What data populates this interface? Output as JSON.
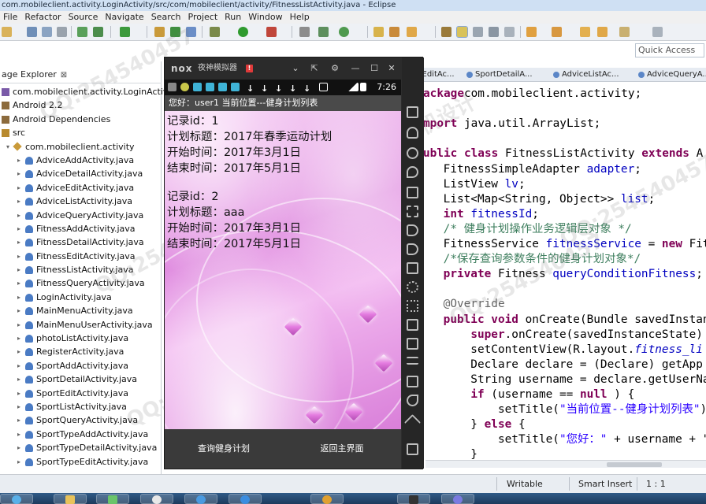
{
  "window": {
    "title": "com.mobileclient.activity.LoginActivity/src/com/mobileclient/activity/FitnessListActivity.java - Eclipse"
  },
  "menu": [
    "File",
    "Refactor",
    "Source",
    "Navigate",
    "Search",
    "Project",
    "Run",
    "Window",
    "Help"
  ],
  "quick_access": {
    "placeholder": "Quick Access"
  },
  "package_explorer": {
    "tab_label": "age Explorer",
    "close_glyph": "⊠",
    "tree": [
      {
        "label": "com.mobileclient.activity.LoginActivity",
        "level": 0,
        "icon": "project-icon",
        "arrow": ""
      },
      {
        "label": "Android 2.2",
        "level": 0,
        "icon": "library-icon",
        "arrow": ""
      },
      {
        "label": "Android Dependencies",
        "level": 0,
        "icon": "library-icon",
        "arrow": ""
      },
      {
        "label": "src",
        "level": 0,
        "icon": "source-folder-icon",
        "arrow": ""
      },
      {
        "label": "com.mobileclient.activity",
        "level": 1,
        "icon": "package-icon",
        "arrow": "▾"
      },
      {
        "label": "AdviceAddActivity.java",
        "level": 2,
        "icon": "java-file-icon",
        "arrow": "▸"
      },
      {
        "label": "AdviceDetailActivity.java",
        "level": 2,
        "icon": "java-file-icon",
        "arrow": "▸"
      },
      {
        "label": "AdviceEditActivity.java",
        "level": 2,
        "icon": "java-file-icon",
        "arrow": "▸"
      },
      {
        "label": "AdviceListActivity.java",
        "level": 2,
        "icon": "java-file-icon",
        "arrow": "▸"
      },
      {
        "label": "AdviceQueryActivity.java",
        "level": 2,
        "icon": "java-file-icon",
        "arrow": "▸"
      },
      {
        "label": "FitnessAddActivity.java",
        "level": 2,
        "icon": "java-file-icon",
        "arrow": "▸"
      },
      {
        "label": "FitnessDetailActivity.java",
        "level": 2,
        "icon": "java-file-icon",
        "arrow": "▸"
      },
      {
        "label": "FitnessEditActivity.java",
        "level": 2,
        "icon": "java-file-icon",
        "arrow": "▸"
      },
      {
        "label": "FitnessListActivity.java",
        "level": 2,
        "icon": "java-file-icon",
        "arrow": "▸"
      },
      {
        "label": "FitnessQueryActivity.java",
        "level": 2,
        "icon": "java-file-icon",
        "arrow": "▸"
      },
      {
        "label": "LoginActivity.java",
        "level": 2,
        "icon": "java-file-icon",
        "arrow": "▸"
      },
      {
        "label": "MainMenuActivity.java",
        "level": 2,
        "icon": "java-file-icon",
        "arrow": "▸"
      },
      {
        "label": "MainMenuUserActivity.java",
        "level": 2,
        "icon": "java-file-icon",
        "arrow": "▸"
      },
      {
        "label": "photoListActivity.java",
        "level": 2,
        "icon": "java-file-icon",
        "arrow": "▸"
      },
      {
        "label": "RegisterActivity.java",
        "level": 2,
        "icon": "java-file-icon",
        "arrow": "▸"
      },
      {
        "label": "SportAddActivity.java",
        "level": 2,
        "icon": "java-file-icon",
        "arrow": "▸"
      },
      {
        "label": "SportDetailActivity.java",
        "level": 2,
        "icon": "java-file-icon",
        "arrow": "▸"
      },
      {
        "label": "SportEditActivity.java",
        "level": 2,
        "icon": "java-file-icon",
        "arrow": "▸"
      },
      {
        "label": "SportListActivity.java",
        "level": 2,
        "icon": "java-file-icon",
        "arrow": "▸"
      },
      {
        "label": "SportQueryActivity.java",
        "level": 2,
        "icon": "java-file-icon",
        "arrow": "▸"
      },
      {
        "label": "SportTypeAddActivity.java",
        "level": 2,
        "icon": "java-file-icon",
        "arrow": "▸"
      },
      {
        "label": "SportTypeDetailActivity.java",
        "level": 2,
        "icon": "java-file-icon",
        "arrow": "▸"
      },
      {
        "label": "SportTypeEditActivity.java",
        "level": 2,
        "icon": "java-file-icon",
        "arrow": "▸"
      }
    ]
  },
  "editor_tabs": [
    "portEditAc...",
    "SportDetailA...",
    "AdviceListAc...",
    "AdviceQueryA..."
  ],
  "editor": {
    "lines": [
      [
        [
          "kw",
          "ackage"
        ],
        [
          "",
          "com.mobileclient.activity;"
        ]
      ],
      [],
      [
        [
          "kw",
          "mport"
        ],
        [
          "",
          " java.util.ArrayList;"
        ]
      ],
      [],
      [
        [
          "kw",
          "ublic class"
        ],
        [
          "",
          " FitnessListActivity "
        ],
        [
          "kw",
          "extends"
        ],
        [
          "",
          " A"
        ]
      ],
      [
        [
          "",
          "    FitnessSimpleAdapter "
        ],
        [
          "fld",
          "adapter"
        ],
        [
          "",
          ";"
        ]
      ],
      [
        [
          "",
          "    ListView "
        ],
        [
          "fld",
          "lv"
        ],
        [
          "",
          ";"
        ]
      ],
      [
        [
          "",
          "    List<Map<String, Object>> "
        ],
        [
          "fld",
          "list"
        ],
        [
          "",
          ";"
        ]
      ],
      [
        [
          "",
          "    "
        ],
        [
          "kw",
          "int"
        ],
        [
          "",
          ""
        ],
        [
          "fld",
          " fitnessId"
        ],
        [
          "",
          ";"
        ]
      ],
      [
        [
          "",
          "    "
        ],
        [
          "cmt",
          "/* 健身计划操作业务逻辑层对象 */"
        ]
      ],
      [
        [
          "",
          "    FitnessService "
        ],
        [
          "fld",
          "fitnessService"
        ],
        [
          "",
          " = "
        ],
        [
          "kw",
          "new"
        ],
        [
          "",
          " Fit"
        ]
      ],
      [
        [
          "",
          "    "
        ],
        [
          "cmt",
          "/*保存查询参数条件的健身计划对象*/"
        ]
      ],
      [
        [
          "",
          "    "
        ],
        [
          "kw",
          "private"
        ],
        [
          "",
          " Fitness "
        ],
        [
          "fld",
          "queryConditionFitness"
        ],
        [
          "",
          ";"
        ]
      ],
      [],
      [
        [
          "",
          "    "
        ],
        [
          "ann",
          "@Override"
        ]
      ],
      [
        [
          "",
          "    "
        ],
        [
          "kw",
          "public void"
        ],
        [
          "",
          " onCreate(Bundle savedInstan"
        ]
      ],
      [
        [
          "",
          "        "
        ],
        [
          "kw",
          "super"
        ],
        [
          "",
          ".onCreate(savedInstanceState)"
        ]
      ],
      [
        [
          "",
          "        setContentView(R.layout."
        ],
        [
          "fld itl",
          "fitness_li"
        ]
      ],
      [
        [
          "",
          "        Declare declare = (Declare) getApp"
        ]
      ],
      [
        [
          "",
          "        String username = declare.getUserNa"
        ]
      ],
      [
        [
          "",
          "        "
        ],
        [
          "kw",
          "if"
        ],
        [
          "",
          " (username == "
        ],
        [
          "kw",
          "null"
        ],
        [
          "",
          " ) {"
        ]
      ],
      [
        [
          "",
          "            setTitle("
        ],
        [
          "str",
          "\"当前位置--健身计划列表\""
        ],
        [
          "",
          ");"
        ]
      ],
      [
        [
          "",
          "        } "
        ],
        [
          "kw",
          "else"
        ],
        [
          "",
          " {"
        ]
      ],
      [
        [
          "",
          "            setTitle("
        ],
        [
          "str",
          "\"您好：\""
        ],
        [
          "",
          " + username + \""
        ]
      ],
      [
        [
          "",
          "        }"
        ]
      ]
    ]
  },
  "status_bar": {
    "writable": "Writable",
    "insert_mode": "Smart Insert",
    "position": "1 : 1"
  },
  "emulator": {
    "logo": "nox",
    "name": "夜神模拟器",
    "alert": "!",
    "time": "7:26",
    "action_bar": "您好：user1  当前位置---健身计划列表",
    "records": [
      {
        "id_label": "记录id：",
        "id": "1",
        "title_label": "计划标题：",
        "title": "2017年春季运动计划",
        "start_label": "开始时间：",
        "start": "2017年3月1日",
        "end_label": "结束时间：",
        "end": "2017年5月1日"
      },
      {
        "id_label": "记录id：",
        "id": "2",
        "title_label": "计划标题：",
        "title": "aaa",
        "start_label": "开始时间：",
        "start": "2017年3月1日",
        "end_label": "结束时间：",
        "end": "2017年5月1日"
      }
    ],
    "buttons": {
      "query": "查询健身计划",
      "back": "返回主界面"
    },
    "download_glyph": "↓"
  },
  "colors": {
    "keyword": "#7f0055",
    "field": "#0000c0",
    "comment": "#3f7f5f",
    "string": "#2a00ff",
    "phone_bg": "#eaa6e8"
  }
}
